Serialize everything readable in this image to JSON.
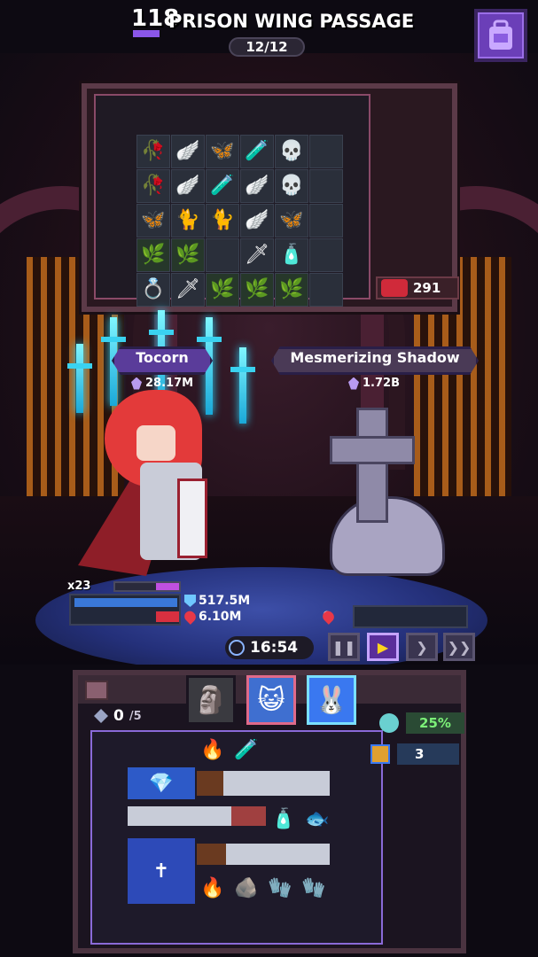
{
  "header": {
    "level": "118",
    "title": "PRISON WING PASSAGE",
    "wave_progress": "12/12",
    "bag_button_icon": "backpack-icon"
  },
  "enemy_loot": {
    "grid": [
      [
        "rose",
        "stone-wing",
        "butterfly",
        "potion-pink",
        "skull-medal",
        ""
      ],
      [
        "rose",
        "stone-wing",
        "potion-pink",
        "stone-wing",
        "skull-medal",
        ""
      ],
      [
        "butterfly",
        "black-cat",
        "black-cat",
        "stone-wing",
        "butterfly",
        ""
      ],
      [
        "thorn-vine",
        "thorn-vine",
        "",
        "dagger",
        "potion-bottle",
        ""
      ],
      [
        "ring",
        "dagger",
        "thorn-vine",
        "thorn-vine",
        "thorn-vine",
        ""
      ]
    ],
    "bounty": "291"
  },
  "hero": {
    "name": "Tocorn",
    "power": "28.17M",
    "combo": "x23",
    "shield": "517.5M",
    "hp": "6.10M"
  },
  "enemy": {
    "name": "Mesmerizing Shadow",
    "power": "1.72B",
    "hp": "0"
  },
  "timer": "16:54",
  "controls": {
    "pause": "❚❚",
    "play": "▶",
    "fast": "❯",
    "fastest": "❯❯",
    "active": "play"
  },
  "bottom": {
    "slots": "0",
    "slots_max": "/5",
    "party": [
      "armored-ghost",
      "blue-cat",
      "white-rabbit"
    ],
    "crit_rate": "25%",
    "gem_count": "3"
  },
  "colors": {
    "accent": "#6b3fb8",
    "hp": "#d83040",
    "shield": "#3a78d8",
    "crit": "#7cf078"
  }
}
